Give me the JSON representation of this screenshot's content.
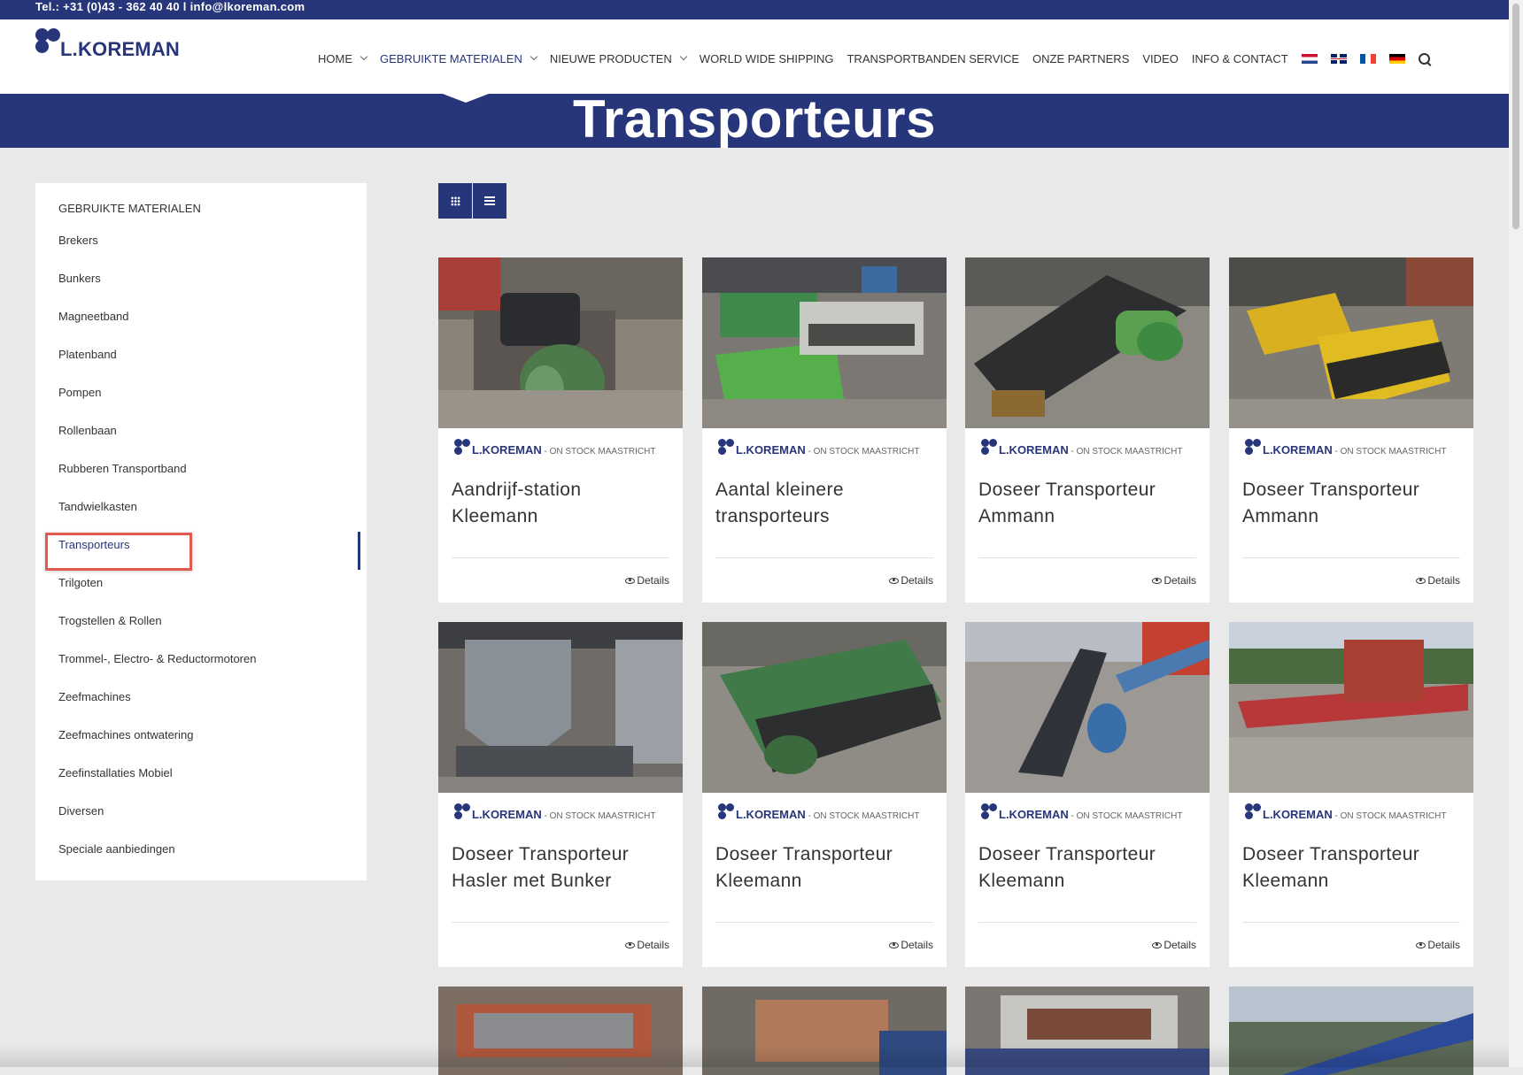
{
  "topbar": {
    "contact": "Tel.: +31 (0)43 - 362 40 40  l  info@lkoreman.com"
  },
  "logo": {
    "text": "L.KOREMAN"
  },
  "nav": {
    "home": "HOME",
    "gebruikte": "GEBRUIKTE MATERIALEN",
    "nieuwe": "NIEUWE PRODUCTEN",
    "shipping": "WORLD WIDE SHIPPING",
    "transportbanden": "TRANSPORTBANDEN SERVICE",
    "partners": "ONZE PARTNERS",
    "video": "VIDEO",
    "contact": "INFO & CONTACT"
  },
  "page": {
    "title": "Transporteurs"
  },
  "sidebar": {
    "title": "GEBRUIKTE MATERIALEN",
    "items": [
      "Brekers",
      "Bunkers",
      "Magneetband",
      "Platenband",
      "Pompen",
      "Rollenbaan",
      "Rubberen Transportband",
      "Tandwielkasten",
      "Transporteurs",
      "Trilgoten",
      "Trogstellen & Rollen",
      "Trommel-, Electro- & Reductormotoren",
      "Zeefmachines",
      "Zeefmachines ontwatering",
      "Zeefinstallaties Mobiel",
      "Diversen",
      "Speciale aanbiedingen"
    ]
  },
  "brand": {
    "name": "L.KOREMAN",
    "suffix": " - ON STOCK MAASTRICHT"
  },
  "cards": [
    {
      "title": "Aandrijf-station Kleemann",
      "details": "Details"
    },
    {
      "title": "Aantal kleinere transporteurs",
      "details": "Details"
    },
    {
      "title": "Doseer Transporteur Ammann",
      "details": "Details"
    },
    {
      "title": "Doseer Transporteur Ammann",
      "details": "Details"
    },
    {
      "title": "Doseer Transporteur Hasler met Bunker",
      "details": "Details"
    },
    {
      "title": "Doseer Transporteur Kleemann",
      "details": "Details"
    },
    {
      "title": "Doseer Transporteur Kleemann",
      "details": "Details"
    },
    {
      "title": "Doseer Transporteur Kleemann",
      "details": "Details"
    }
  ],
  "colors": {
    "brand_blue": "#27357b",
    "highlight_red": "#e05a4f",
    "background": "#e9e9e9"
  }
}
